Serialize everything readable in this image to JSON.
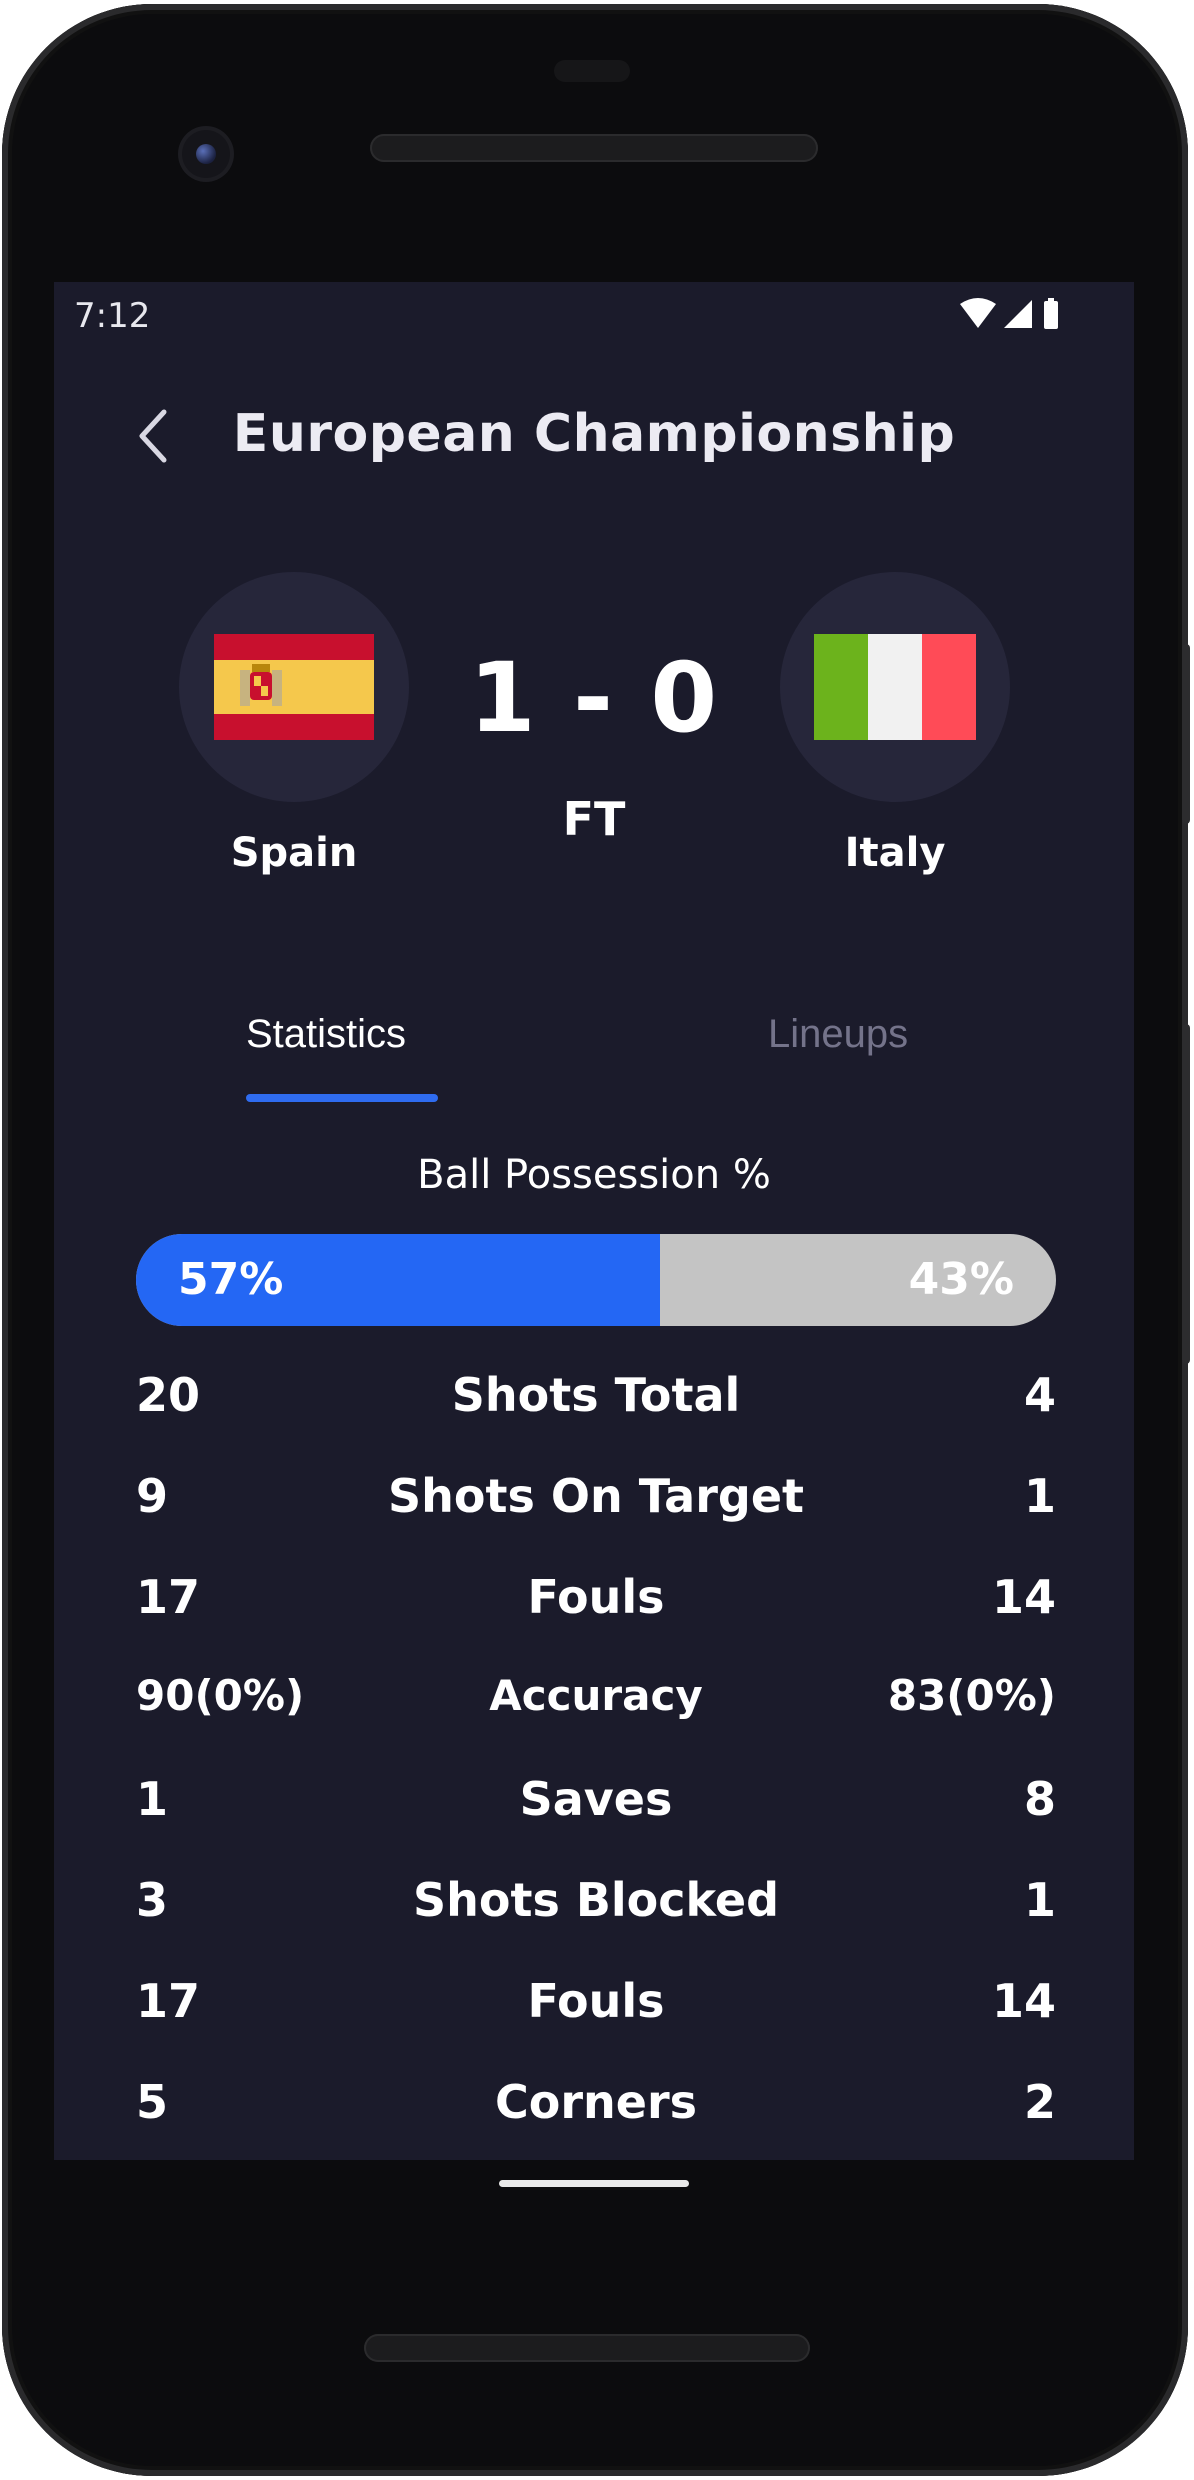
{
  "status_bar": {
    "time": "7:12",
    "icons": [
      "wifi-icon",
      "signal-icon",
      "battery-icon"
    ]
  },
  "header": {
    "title": "European Championship",
    "back_icon": "chevron-left-icon"
  },
  "match": {
    "home": {
      "name": "Spain",
      "flag_colors": [
        "#c8102e",
        "#f5c84c",
        "#c8102e"
      ]
    },
    "away": {
      "name": "Italy",
      "flag_colors": [
        "#6cb31c",
        "#f1f1f1",
        "#ff4b57"
      ]
    },
    "score": "1 - 0",
    "status": "FT"
  },
  "tabs": [
    {
      "label": "Statistics",
      "active": true
    },
    {
      "label": "Lineups",
      "active": false
    }
  ],
  "possession": {
    "title": "Ball Possession %",
    "home": 57,
    "away": 43,
    "home_label": "57%",
    "away_label": "43%",
    "home_color": "#2467f4",
    "away_color": "#c4c4c4"
  },
  "stats": [
    {
      "label": "Shots Total",
      "home": "20",
      "away": "4"
    },
    {
      "label": "Shots On Target",
      "home": "9",
      "away": "1"
    },
    {
      "label": "Fouls",
      "home": "17",
      "away": "14"
    },
    {
      "label": "Accuracy",
      "home": "90(0%)",
      "away": "83(0%)"
    },
    {
      "label": "Saves",
      "home": "1",
      "away": "8"
    },
    {
      "label": "Shots Blocked",
      "home": "3",
      "away": "1"
    },
    {
      "label": "Fouls",
      "home": "17",
      "away": "14"
    },
    {
      "label": "Corners",
      "home": "5",
      "away": "2"
    }
  ],
  "colors": {
    "background": "#1b1b2b",
    "accent": "#2f6cf0",
    "inactive_text": "#74738a"
  }
}
